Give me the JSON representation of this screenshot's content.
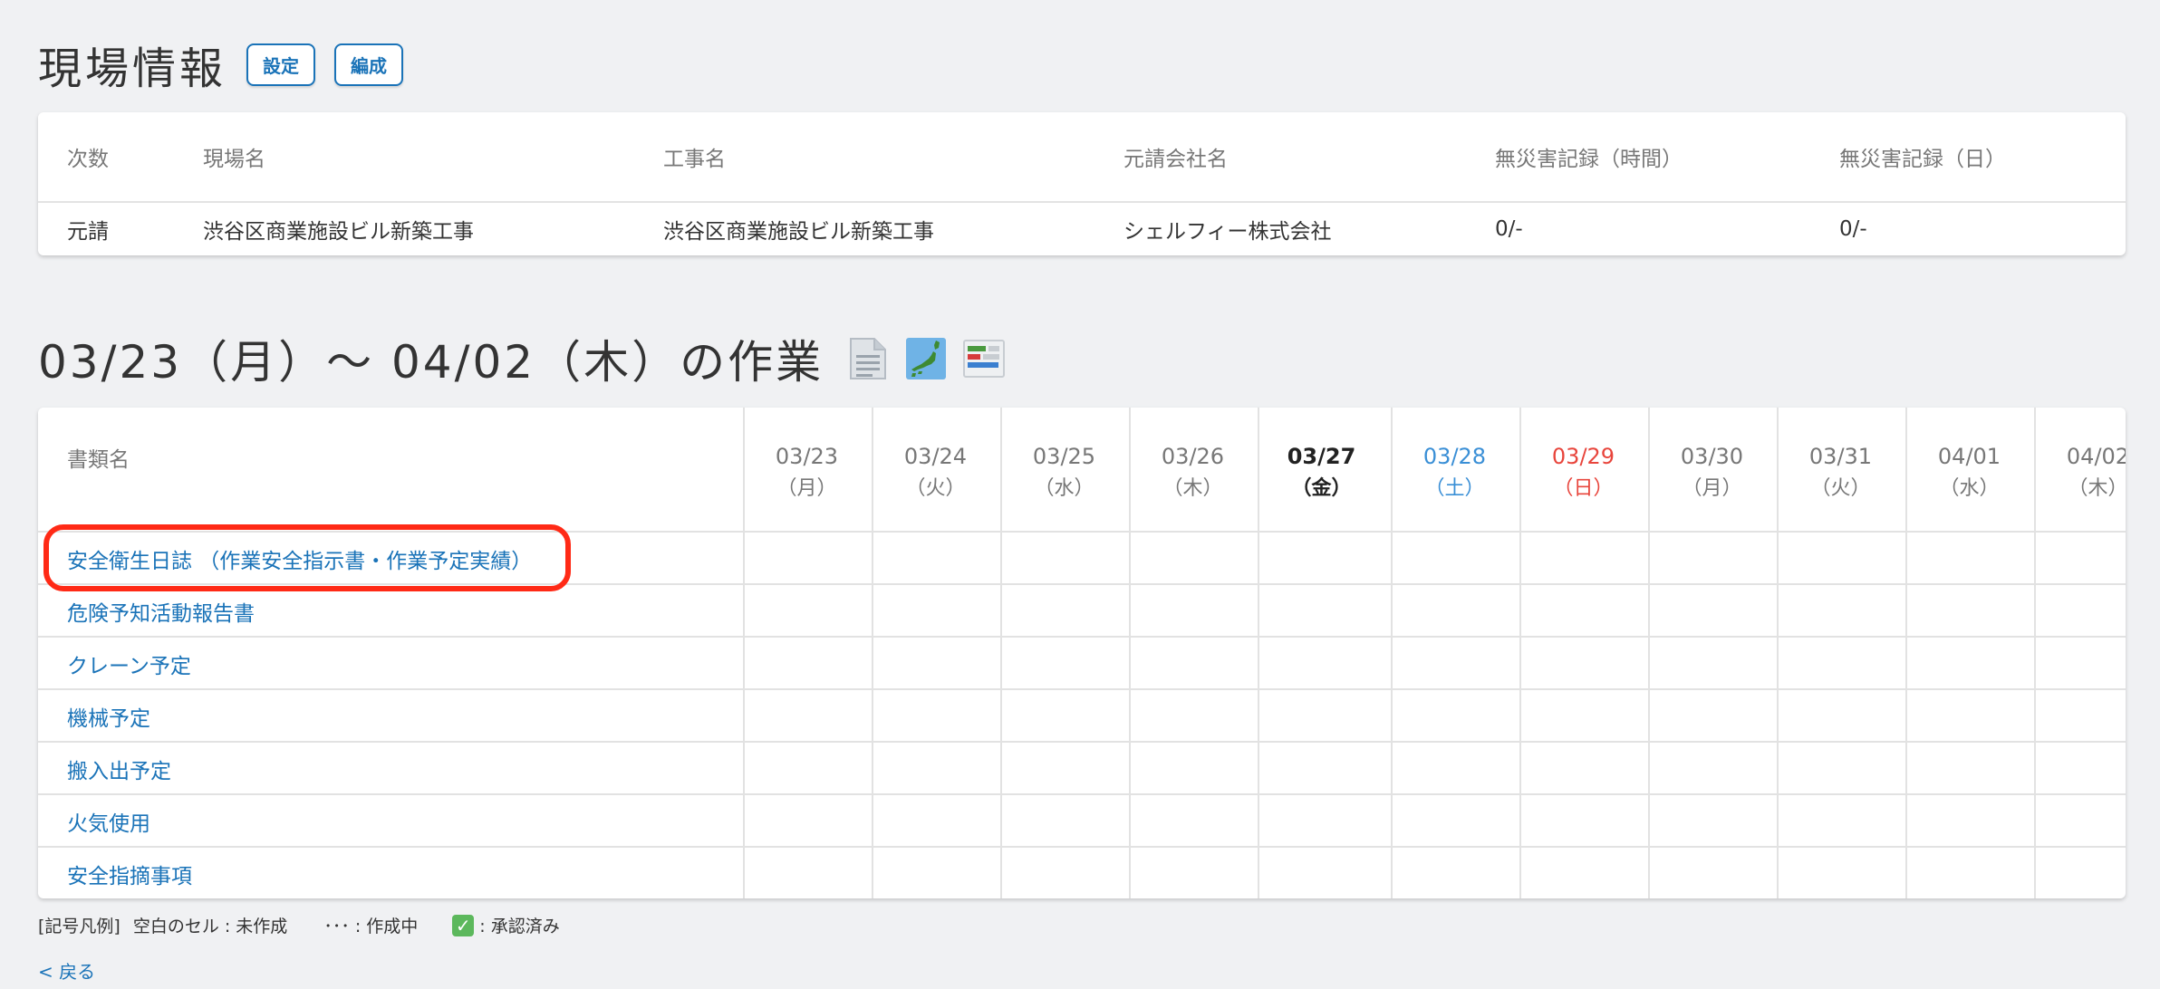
{
  "header": {
    "title": "現場情報",
    "settings_label": "設定",
    "edit_label": "編成"
  },
  "info_table": {
    "columns": [
      "次数",
      "現場名",
      "工事名",
      "元請会社名",
      "無災害記録（時間）",
      "無災害記録（日）"
    ],
    "row": [
      "元請",
      "渋谷区商業施設ビル新築工事",
      "渋谷区商業施設ビル新築工事",
      "シェルフィー株式会社",
      "0/-",
      "0/-"
    ]
  },
  "work": {
    "title": "03/23（月）〜 04/02（木）の作業",
    "icons": [
      "document-icon",
      "japan-map-icon",
      "gantt-chart-icon"
    ]
  },
  "schedule": {
    "name_header": "書類名",
    "dates": [
      {
        "date": "03/23",
        "dow": "（月）",
        "kind": "normal"
      },
      {
        "date": "03/24",
        "dow": "（火）",
        "kind": "normal"
      },
      {
        "date": "03/25",
        "dow": "（水）",
        "kind": "normal"
      },
      {
        "date": "03/26",
        "dow": "（木）",
        "kind": "normal"
      },
      {
        "date": "03/27",
        "dow": "（金）",
        "kind": "today"
      },
      {
        "date": "03/28",
        "dow": "（土）",
        "kind": "sat"
      },
      {
        "date": "03/29",
        "dow": "（日）",
        "kind": "sun"
      },
      {
        "date": "03/30",
        "dow": "（月）",
        "kind": "normal"
      },
      {
        "date": "03/31",
        "dow": "（火）",
        "kind": "normal"
      },
      {
        "date": "04/01",
        "dow": "（水）",
        "kind": "normal"
      },
      {
        "date": "04/02",
        "dow": "（木）",
        "kind": "normal"
      }
    ],
    "documents": [
      "安全衛生日誌 （作業安全指示書・作業予定実績）",
      "危険予知活動報告書",
      "クレーン予定",
      "機械予定",
      "搬入出予定",
      "火気使用",
      "安全指摘事項"
    ]
  },
  "legend": {
    "prefix": "[記号凡例]",
    "blank": "空白のセル : 未作成",
    "in_progress": "･･･ : 作成中",
    "check_mark": "✓",
    "approved": ": 承認済み"
  },
  "back_label": "< 戻る",
  "colors": {
    "accent": "#1a73b8",
    "saturday": "#3a8fd6",
    "sunday": "#e8453c",
    "highlight": "#ff2a16",
    "approved": "#5cb85c"
  }
}
